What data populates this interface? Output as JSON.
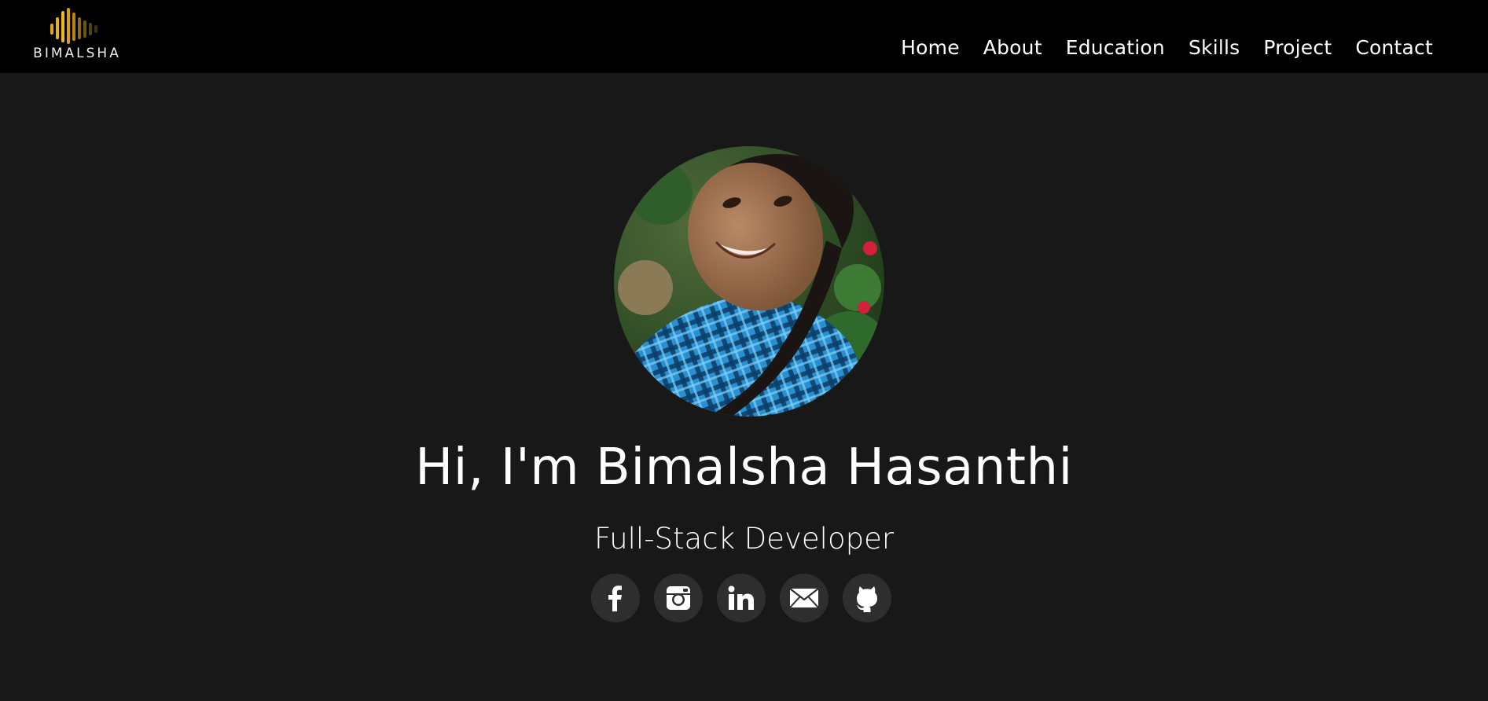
{
  "brand": {
    "logo_text": "BIMALSHA",
    "logo_icon": "soundwave-bars-icon",
    "accent": "#d4a017"
  },
  "nav": {
    "items": [
      {
        "label": "Home"
      },
      {
        "label": "About"
      },
      {
        "label": "Education"
      },
      {
        "label": "Skills"
      },
      {
        "label": "Project"
      },
      {
        "label": "Contact"
      }
    ]
  },
  "hero": {
    "headline": "Hi, I'm Bimalsha Hasanthi",
    "subtitle": "Full-Stack Developer",
    "avatar": "profile-photo"
  },
  "socials": [
    {
      "icon": "facebook-icon"
    },
    {
      "icon": "instagram-icon"
    },
    {
      "icon": "linkedin-icon"
    },
    {
      "icon": "email-icon"
    },
    {
      "icon": "github-icon"
    }
  ],
  "colors": {
    "navbar_bg": "#000000",
    "page_bg": "#181818",
    "social_bg": "#2e2e2e",
    "text": "#ffffff"
  }
}
